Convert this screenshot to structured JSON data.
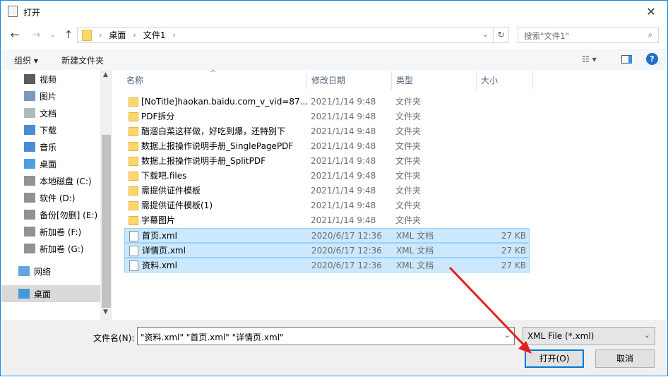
{
  "window": {
    "title": "打开"
  },
  "nav": {
    "back": "←",
    "forward": "→",
    "recent": "⌄",
    "up": "↑",
    "breadcrumb": [
      "桌面",
      "文件1"
    ],
    "search_placeholder": "搜索\"文件1\""
  },
  "toolbar": {
    "organize": "组织 ▾",
    "new_folder": "新建文件夹"
  },
  "sidebar": {
    "items": [
      {
        "label": "视频",
        "icon": "video-icon"
      },
      {
        "label": "图片",
        "icon": "pictures-icon"
      },
      {
        "label": "文档",
        "icon": "documents-icon"
      },
      {
        "label": "下载",
        "icon": "download-icon"
      },
      {
        "label": "音乐",
        "icon": "music-icon"
      },
      {
        "label": "桌面",
        "icon": "desktop-icon"
      },
      {
        "label": "本地磁盘 (C:)",
        "icon": "drive-icon"
      },
      {
        "label": "软件 (D:)",
        "icon": "drive-icon"
      },
      {
        "label": "备份[勿删] (E:)",
        "icon": "drive-icon"
      },
      {
        "label": "新加卷 (F:)",
        "icon": "drive-icon"
      },
      {
        "label": "新加卷 (G:)",
        "icon": "drive-icon"
      },
      {
        "label": "网络",
        "icon": "network-icon"
      },
      {
        "label": "桌面",
        "icon": "desktop-icon"
      }
    ]
  },
  "columns": {
    "name": "名称",
    "date": "修改日期",
    "type": "类型",
    "size": "大小"
  },
  "files": [
    {
      "name": "[NoTitle]haokan.baidu.com_v_vid=87...",
      "date": "2021/1/14 9:48",
      "type": "文件夹",
      "size": "",
      "kind": "folder",
      "selected": false
    },
    {
      "name": "PDF拆分",
      "date": "2021/1/14 9:48",
      "type": "文件夹",
      "size": "",
      "kind": "folder",
      "selected": false
    },
    {
      "name": "醋溜白菜这样做，好吃到爆，还特别下",
      "date": "2021/1/14 9:48",
      "type": "文件夹",
      "size": "",
      "kind": "folder",
      "selected": false
    },
    {
      "name": "数据上报操作说明手册_SinglePagePDF",
      "date": "2021/1/14 9:48",
      "type": "文件夹",
      "size": "",
      "kind": "folder",
      "selected": false
    },
    {
      "name": "数据上报操作说明手册_SplitPDF",
      "date": "2021/1/14 9:48",
      "type": "文件夹",
      "size": "",
      "kind": "folder",
      "selected": false
    },
    {
      "name": "下载吧.files",
      "date": "2021/1/14 9:48",
      "type": "文件夹",
      "size": "",
      "kind": "folder",
      "selected": false
    },
    {
      "name": "需提供证件模板",
      "date": "2021/1/14 9:48",
      "type": "文件夹",
      "size": "",
      "kind": "folder",
      "selected": false
    },
    {
      "name": "需提供证件模板(1)",
      "date": "2021/1/14 9:48",
      "type": "文件夹",
      "size": "",
      "kind": "folder",
      "selected": false
    },
    {
      "name": "字幕图片",
      "date": "2021/1/14 9:48",
      "type": "文件夹",
      "size": "",
      "kind": "folder",
      "selected": false
    },
    {
      "name": "首页.xml",
      "date": "2020/6/17 12:36",
      "type": "XML 文档",
      "size": "27 KB",
      "kind": "xml",
      "selected": true
    },
    {
      "name": "详情页.xml",
      "date": "2020/6/17 12:36",
      "type": "XML 文档",
      "size": "27 KB",
      "kind": "xml",
      "selected": true
    },
    {
      "name": "资料.xml",
      "date": "2020/6/17 12:36",
      "type": "XML 文档",
      "size": "27 KB",
      "kind": "xml",
      "selected": true
    }
  ],
  "footer": {
    "filename_label": "文件名(N):",
    "filename_value": "\"资料.xml\" \"首页.xml\" \"详情页.xml\"",
    "filetype": "XML File (*.xml)",
    "open": "打开(O)",
    "cancel": "取消"
  }
}
